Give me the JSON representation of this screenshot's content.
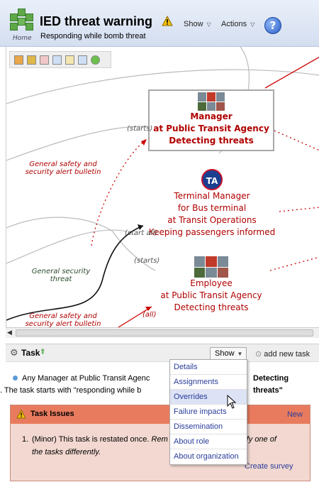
{
  "header": {
    "title": "IED threat warning",
    "subtitle": "Responding while bomb threat",
    "home_label": "Home",
    "show_label": "Show",
    "actions_label": "Actions",
    "help_symbol": "?",
    "icons": [
      "home-cubes-icon",
      "warning-icon",
      "help-icon"
    ]
  },
  "map": {
    "nodes": [
      {
        "lines": [
          "Manager",
          "at Public Transit Agency",
          "Detecting threats"
        ],
        "bold": true,
        "selected": true
      },
      {
        "lines": [
          "Terminal Manager",
          "for Bus terminal",
          "at Transit Operations",
          "Keeping passengers informed"
        ],
        "bold": false,
        "selected": false
      },
      {
        "lines": [
          "Employee",
          "at Public Transit Agency",
          "Detecting threats"
        ],
        "bold": false,
        "selected": false
      }
    ],
    "logo_text": "TA",
    "edge_labels": {
      "starts_1": "(starts)",
      "starts_2": "(start all)",
      "starts_3": "(starts)",
      "all": "(all)",
      "bulletin_1": "General safety and security alert bulletin",
      "threat": "General security threat",
      "bulletin_2": "General safety and security alert bulletin"
    }
  },
  "task": {
    "title": "Task",
    "show_label": "Show",
    "add_label": "add new task",
    "desc_prefix": "Any Manager at Public Transit Agenc",
    "desc_suffix": "Detecting threats\"",
    "desc_line2": ". The task starts with \"responding while b",
    "issues_title": "Task Issues",
    "issues_new": "New",
    "issue_number": "1.",
    "issue_text_a": "(Minor) This task is restated once. ",
    "issue_text_b": "Rem",
    "issue_text_c": "specify one of",
    "issue_text_d": "the tasks differently.",
    "create_survey": "Create survey"
  },
  "menu": {
    "items": [
      "Details",
      "Assignments",
      "Overrides",
      "Failure impacts",
      "Dissemination",
      "About role",
      "About organization"
    ],
    "hovered": "Overrides"
  },
  "colors": {
    "node_red": "#b00000",
    "issues_header": "#e87b5e",
    "issues_body": "#f2d8d0",
    "link_blue": "#2a3d9a"
  }
}
